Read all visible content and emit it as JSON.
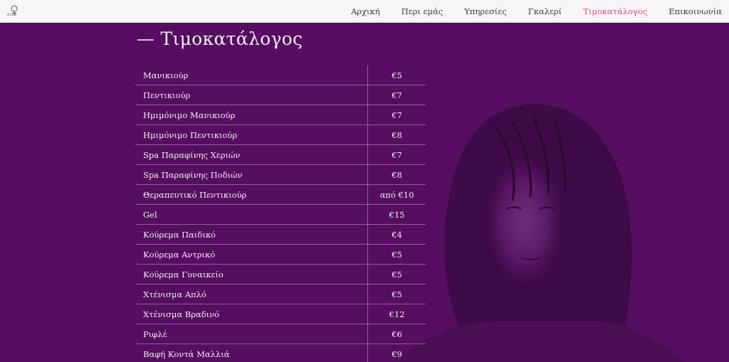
{
  "brand": {
    "logo_text": "Eυνα"
  },
  "nav": {
    "items": [
      {
        "label": "Αρχική",
        "active": false
      },
      {
        "label": "Περι εμάς",
        "active": false
      },
      {
        "label": "Υπηρεσίες",
        "active": false
      },
      {
        "label": "Γκαλερί",
        "active": false
      },
      {
        "label": "Τιμοκατάλογος",
        "active": true
      },
      {
        "label": "Επικοινωνία",
        "active": false
      }
    ]
  },
  "pricelist": {
    "title": "— Τιμοκατάλογος",
    "rows": [
      {
        "service": "Μανικιούρ",
        "price": "€5"
      },
      {
        "service": "Πεντικιούρ",
        "price": "€7"
      },
      {
        "service": "Ημιμόνιμο Μανικιούρ",
        "price": "€7"
      },
      {
        "service": "Ημιμόνιμο Πεντικιούρ",
        "price": "€8"
      },
      {
        "service": "Spa Παραφίνης Χεριών",
        "price": "€7"
      },
      {
        "service": "Spa Παραφίνης Ποδιών",
        "price": "€8"
      },
      {
        "service": "Θεραπευτικό Πεντικιούρ",
        "price": "από €10"
      },
      {
        "service": "Gel",
        "price": "€15"
      },
      {
        "service": "Κούρεμα Παιδικό",
        "price": "€4"
      },
      {
        "service": "Κούρεμα Αντρικό",
        "price": "€5"
      },
      {
        "service": "Κούρεμα Γυναικείο",
        "price": "€5"
      },
      {
        "service": "Χτένισμα Απλό",
        "price": "€5"
      },
      {
        "service": "Χτένισμα Βραδινό",
        "price": "€12"
      },
      {
        "service": "Ριφλέ",
        "price": "€6"
      },
      {
        "service": "Βαφή Κοντά Μαλλιά",
        "price": "€9"
      }
    ]
  },
  "theme": {
    "background": "#560e60",
    "nav_background": "#f8f5f9",
    "accent": "#d4478c"
  }
}
